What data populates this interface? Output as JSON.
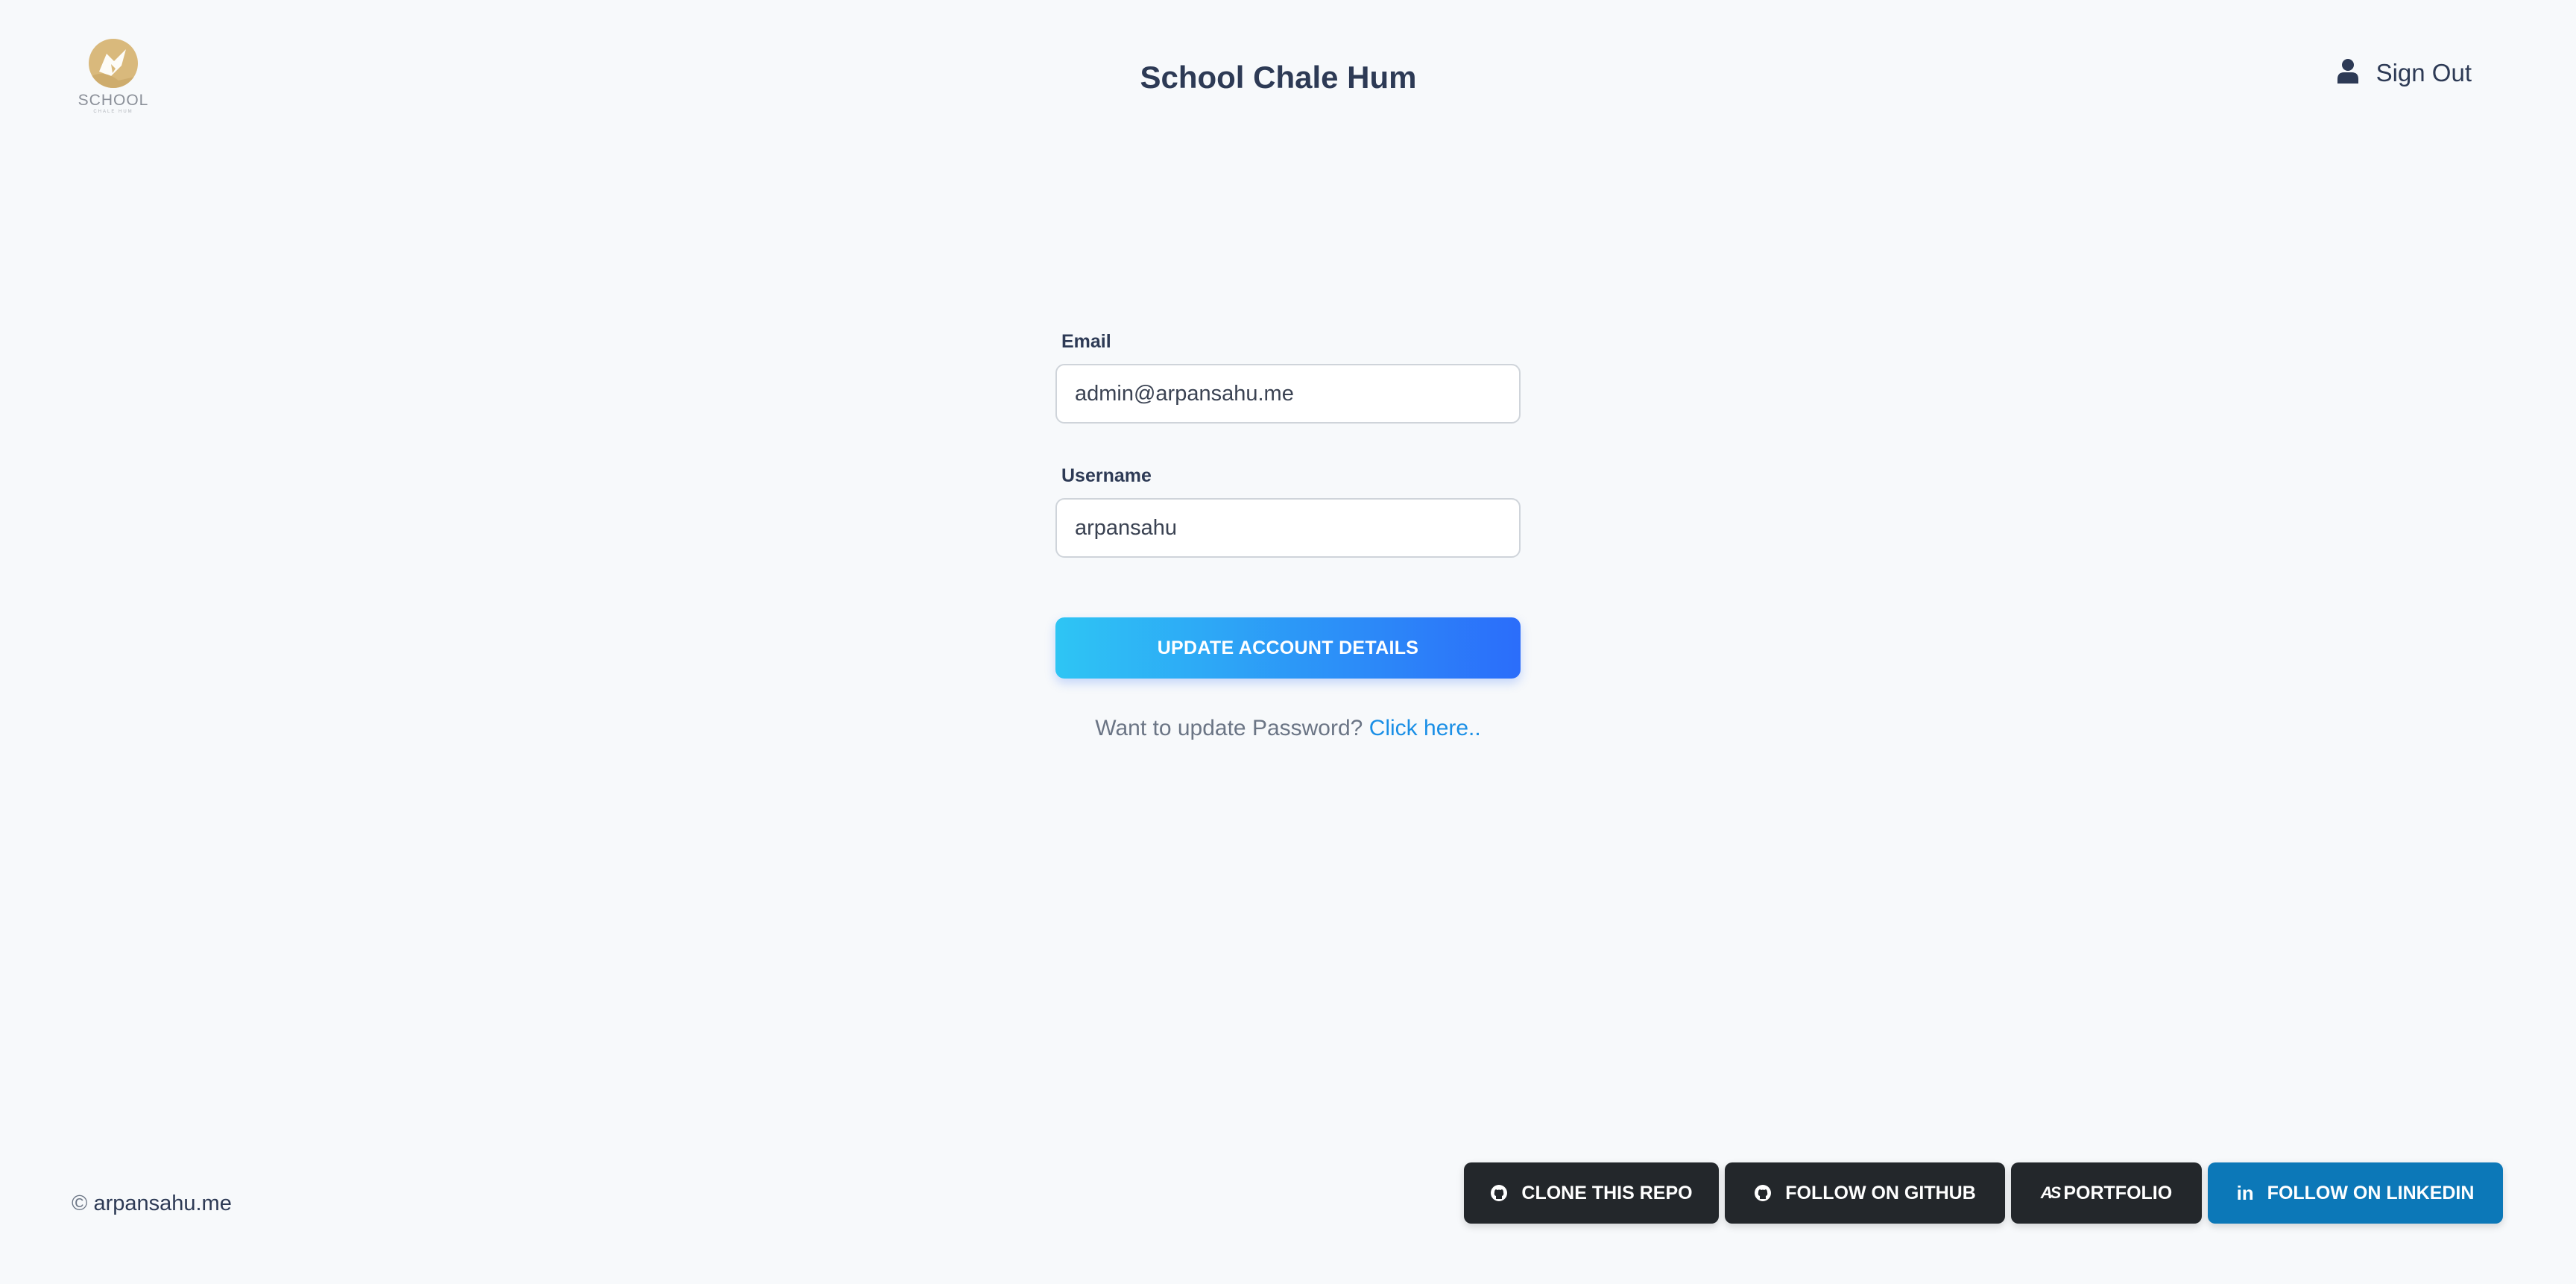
{
  "header": {
    "logo_text": "SCHOOL",
    "logo_subtext": "CHALE HUM",
    "title": "School Chale Hum",
    "signout_label": "Sign Out",
    "signout_icon": "user-icon"
  },
  "form": {
    "email_label": "Email",
    "email_value": "admin@arpansahu.me",
    "username_label": "Username",
    "username_value": "arpansahu",
    "submit_label": "UPDATE ACCOUNT DETAILS",
    "password_prompt": "Want to update Password?",
    "password_link": "Click here.."
  },
  "footer": {
    "copyright_symbol": "©",
    "copyright_text": "arpansahu.me",
    "buttons": [
      {
        "label": "CLONE THIS REPO",
        "icon": "github-icon"
      },
      {
        "label": "FOLLOW ON GITHUB",
        "icon": "github-icon"
      },
      {
        "label": "PORTFOLIO",
        "icon": "portfolio-icon",
        "mark": "AS"
      },
      {
        "label": "FOLLOW ON LINKEDIN",
        "icon": "linkedin-icon",
        "mark": "in"
      }
    ]
  },
  "colors": {
    "background": "#f7f9fb",
    "primary_gradient_start": "#2ec5f4",
    "primary_gradient_end": "#2b6dfa",
    "link": "#1a8fe6",
    "dark_button": "#23272b",
    "linkedin_button": "#0c78b8",
    "logo_gold": "#d9b97c"
  }
}
